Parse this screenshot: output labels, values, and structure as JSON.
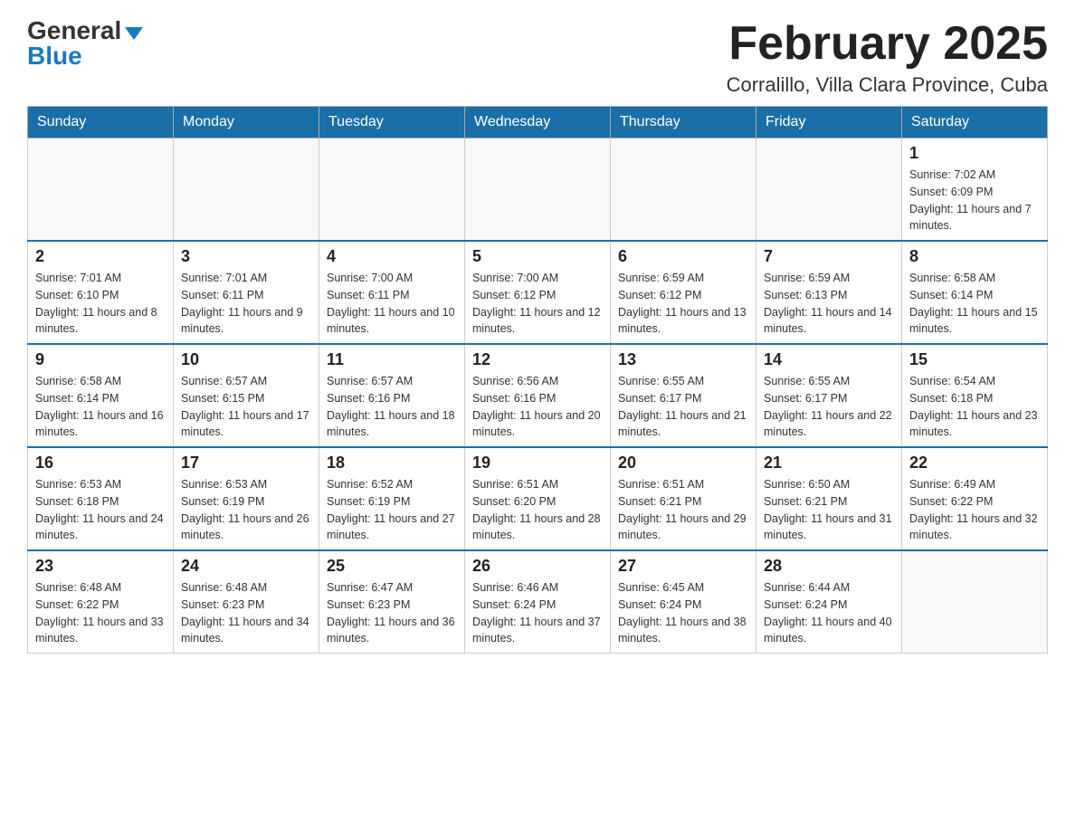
{
  "header": {
    "logo_general": "General",
    "logo_blue": "Blue",
    "month_title": "February 2025",
    "subtitle": "Corralillo, Villa Clara Province, Cuba"
  },
  "days_of_week": [
    "Sunday",
    "Monday",
    "Tuesday",
    "Wednesday",
    "Thursday",
    "Friday",
    "Saturday"
  ],
  "weeks": [
    [
      {
        "day": "",
        "info": ""
      },
      {
        "day": "",
        "info": ""
      },
      {
        "day": "",
        "info": ""
      },
      {
        "day": "",
        "info": ""
      },
      {
        "day": "",
        "info": ""
      },
      {
        "day": "",
        "info": ""
      },
      {
        "day": "1",
        "info": "Sunrise: 7:02 AM\nSunset: 6:09 PM\nDaylight: 11 hours and 7 minutes."
      }
    ],
    [
      {
        "day": "2",
        "info": "Sunrise: 7:01 AM\nSunset: 6:10 PM\nDaylight: 11 hours and 8 minutes."
      },
      {
        "day": "3",
        "info": "Sunrise: 7:01 AM\nSunset: 6:11 PM\nDaylight: 11 hours and 9 minutes."
      },
      {
        "day": "4",
        "info": "Sunrise: 7:00 AM\nSunset: 6:11 PM\nDaylight: 11 hours and 10 minutes."
      },
      {
        "day": "5",
        "info": "Sunrise: 7:00 AM\nSunset: 6:12 PM\nDaylight: 11 hours and 12 minutes."
      },
      {
        "day": "6",
        "info": "Sunrise: 6:59 AM\nSunset: 6:12 PM\nDaylight: 11 hours and 13 minutes."
      },
      {
        "day": "7",
        "info": "Sunrise: 6:59 AM\nSunset: 6:13 PM\nDaylight: 11 hours and 14 minutes."
      },
      {
        "day": "8",
        "info": "Sunrise: 6:58 AM\nSunset: 6:14 PM\nDaylight: 11 hours and 15 minutes."
      }
    ],
    [
      {
        "day": "9",
        "info": "Sunrise: 6:58 AM\nSunset: 6:14 PM\nDaylight: 11 hours and 16 minutes."
      },
      {
        "day": "10",
        "info": "Sunrise: 6:57 AM\nSunset: 6:15 PM\nDaylight: 11 hours and 17 minutes."
      },
      {
        "day": "11",
        "info": "Sunrise: 6:57 AM\nSunset: 6:16 PM\nDaylight: 11 hours and 18 minutes."
      },
      {
        "day": "12",
        "info": "Sunrise: 6:56 AM\nSunset: 6:16 PM\nDaylight: 11 hours and 20 minutes."
      },
      {
        "day": "13",
        "info": "Sunrise: 6:55 AM\nSunset: 6:17 PM\nDaylight: 11 hours and 21 minutes."
      },
      {
        "day": "14",
        "info": "Sunrise: 6:55 AM\nSunset: 6:17 PM\nDaylight: 11 hours and 22 minutes."
      },
      {
        "day": "15",
        "info": "Sunrise: 6:54 AM\nSunset: 6:18 PM\nDaylight: 11 hours and 23 minutes."
      }
    ],
    [
      {
        "day": "16",
        "info": "Sunrise: 6:53 AM\nSunset: 6:18 PM\nDaylight: 11 hours and 24 minutes."
      },
      {
        "day": "17",
        "info": "Sunrise: 6:53 AM\nSunset: 6:19 PM\nDaylight: 11 hours and 26 minutes."
      },
      {
        "day": "18",
        "info": "Sunrise: 6:52 AM\nSunset: 6:19 PM\nDaylight: 11 hours and 27 minutes."
      },
      {
        "day": "19",
        "info": "Sunrise: 6:51 AM\nSunset: 6:20 PM\nDaylight: 11 hours and 28 minutes."
      },
      {
        "day": "20",
        "info": "Sunrise: 6:51 AM\nSunset: 6:21 PM\nDaylight: 11 hours and 29 minutes."
      },
      {
        "day": "21",
        "info": "Sunrise: 6:50 AM\nSunset: 6:21 PM\nDaylight: 11 hours and 31 minutes."
      },
      {
        "day": "22",
        "info": "Sunrise: 6:49 AM\nSunset: 6:22 PM\nDaylight: 11 hours and 32 minutes."
      }
    ],
    [
      {
        "day": "23",
        "info": "Sunrise: 6:48 AM\nSunset: 6:22 PM\nDaylight: 11 hours and 33 minutes."
      },
      {
        "day": "24",
        "info": "Sunrise: 6:48 AM\nSunset: 6:23 PM\nDaylight: 11 hours and 34 minutes."
      },
      {
        "day": "25",
        "info": "Sunrise: 6:47 AM\nSunset: 6:23 PM\nDaylight: 11 hours and 36 minutes."
      },
      {
        "day": "26",
        "info": "Sunrise: 6:46 AM\nSunset: 6:24 PM\nDaylight: 11 hours and 37 minutes."
      },
      {
        "day": "27",
        "info": "Sunrise: 6:45 AM\nSunset: 6:24 PM\nDaylight: 11 hours and 38 minutes."
      },
      {
        "day": "28",
        "info": "Sunrise: 6:44 AM\nSunset: 6:24 PM\nDaylight: 11 hours and 40 minutes."
      },
      {
        "day": "",
        "info": ""
      }
    ]
  ]
}
